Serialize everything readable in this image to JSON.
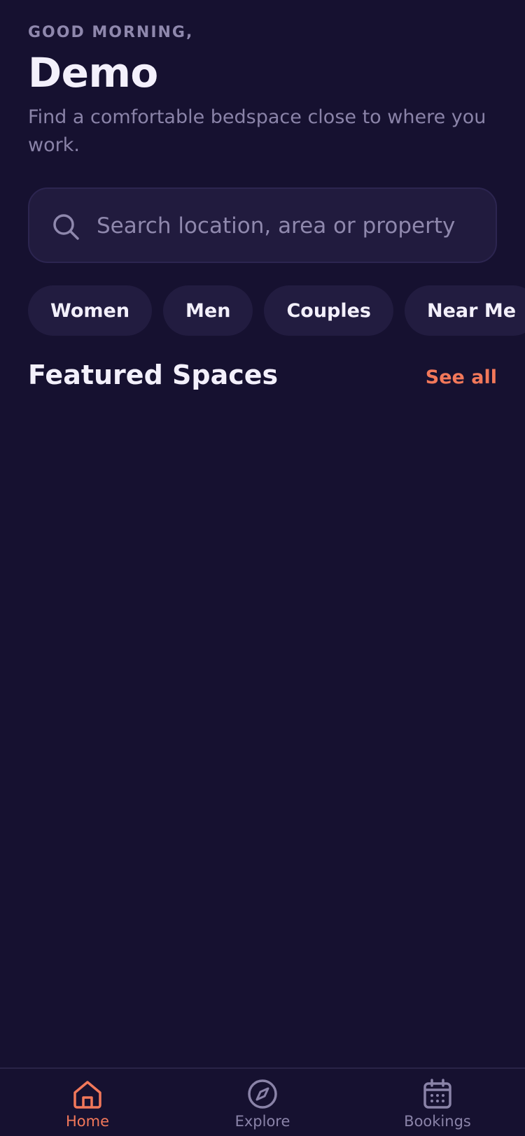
{
  "header": {
    "greeting": "GOOD MORNING,",
    "username": "Demo",
    "subtitle": "Find a comfortable bedspace close to where you work."
  },
  "search": {
    "placeholder": "Search location, area or property",
    "icon": "search-icon"
  },
  "filters": [
    {
      "label": "Women"
    },
    {
      "label": "Men"
    },
    {
      "label": "Couples"
    },
    {
      "label": "Near Me"
    }
  ],
  "featured": {
    "title": "Featured Spaces",
    "see_all_label": "See all"
  },
  "tabbar": {
    "items": [
      {
        "label": "Home",
        "icon": "home-icon",
        "active": true
      },
      {
        "label": "Explore",
        "icon": "compass-icon",
        "active": false
      },
      {
        "label": "Bookings",
        "icon": "calendar-icon",
        "active": false
      }
    ]
  },
  "colors": {
    "background": "#161130",
    "surface": "#211b3e",
    "accent": "#f2785a",
    "text_primary": "#f3f0fb",
    "text_muted": "#8f88ad"
  }
}
